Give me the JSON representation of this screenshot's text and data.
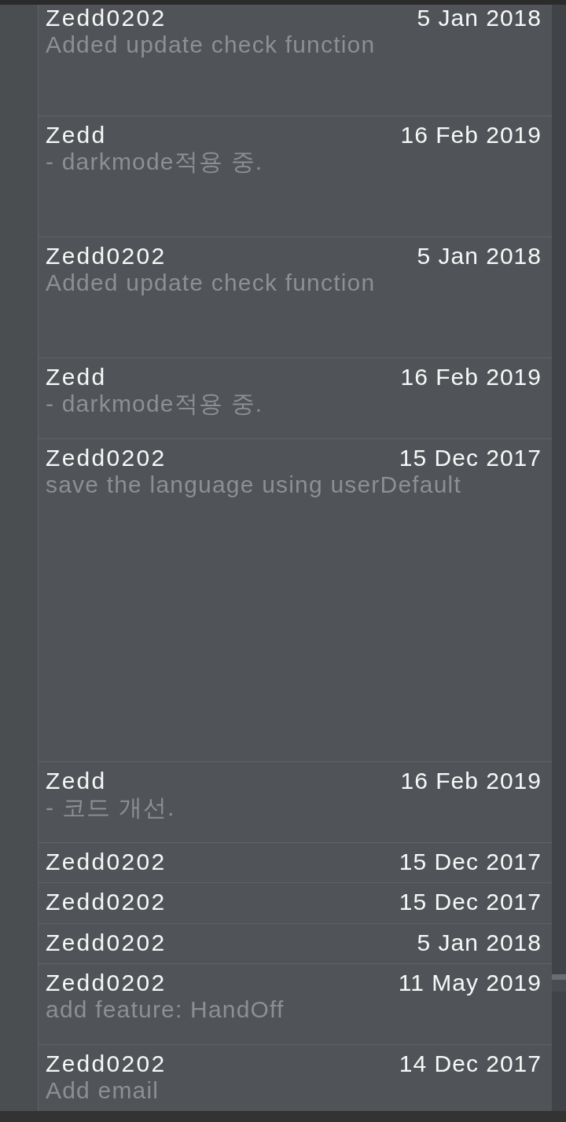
{
  "commits": [
    {
      "author": "Zedd0202",
      "date": "5 Jan 2018",
      "message": "Added update check function"
    },
    {
      "author": "Zedd",
      "date": "16 Feb 2019",
      "message": "- darkmode적용 중."
    },
    {
      "author": "Zedd0202",
      "date": "5 Jan 2018",
      "message": "Added update check function"
    },
    {
      "author": "Zedd",
      "date": "16 Feb 2019",
      "message": "- darkmode적용 중."
    },
    {
      "author": "Zedd0202",
      "date": "15 Dec 2017",
      "message": "save the language using userDefault"
    },
    {
      "author": "Zedd",
      "date": "16 Feb 2019",
      "message": "- 코드 개선."
    },
    {
      "author": "Zedd0202",
      "date": "15 Dec 2017"
    },
    {
      "author": "Zedd0202",
      "date": "15 Dec 2017"
    },
    {
      "author": "Zedd0202",
      "date": "5 Jan 2018"
    },
    {
      "author": "Zedd0202",
      "date": "11 May 2019",
      "message": "add feature: HandOff"
    },
    {
      "author": "Zedd0202",
      "date": "14 Dec 2017",
      "message": "Add email"
    }
  ]
}
